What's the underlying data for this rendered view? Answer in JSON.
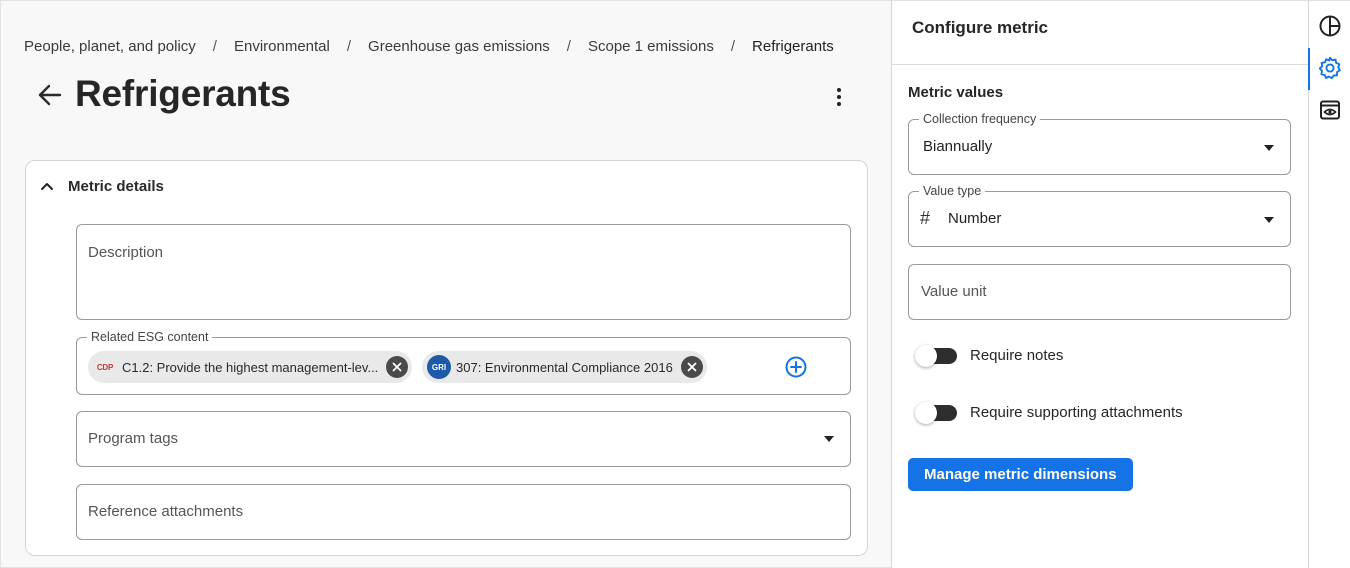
{
  "breadcrumb": {
    "items": [
      "People, planet, and policy",
      "Environmental",
      "Greenhouse gas emissions",
      "Scope 1 emissions"
    ],
    "current": "Refrigerants",
    "separator": "/"
  },
  "page": {
    "title": "Refrigerants"
  },
  "card": {
    "header": "Metric details",
    "description_placeholder": "Description",
    "esg": {
      "legend": "Related ESG content",
      "chips": [
        {
          "logo": "CDP",
          "label": "C1.2: Provide the highest management-lev..."
        },
        {
          "logo": "GRI",
          "label": "307: Environmental Compliance 2016"
        }
      ]
    },
    "program_tags_placeholder": "Program tags",
    "reference_attachments_placeholder": "Reference attachments"
  },
  "panel": {
    "title": "Configure metric",
    "section": "Metric values",
    "collection_frequency": {
      "legend": "Collection frequency",
      "value": "Biannually"
    },
    "value_type": {
      "legend": "Value type",
      "symbol": "#",
      "value": "Number"
    },
    "value_unit_placeholder": "Value unit",
    "require_notes": {
      "label": "Require notes",
      "on": false
    },
    "require_attachments": {
      "label": "Require supporting attachments",
      "on": false
    },
    "manage_button": "Manage metric dimensions"
  },
  "rail": {
    "icons": [
      "pie-chart-icon",
      "gear-icon",
      "preview-icon"
    ],
    "active": "gear-icon"
  },
  "colors": {
    "accent": "#1473e6",
    "toggle_track": "#2e2e2e",
    "gri_blue": "#1d5aa7",
    "cdp_red": "#c23a3a"
  }
}
